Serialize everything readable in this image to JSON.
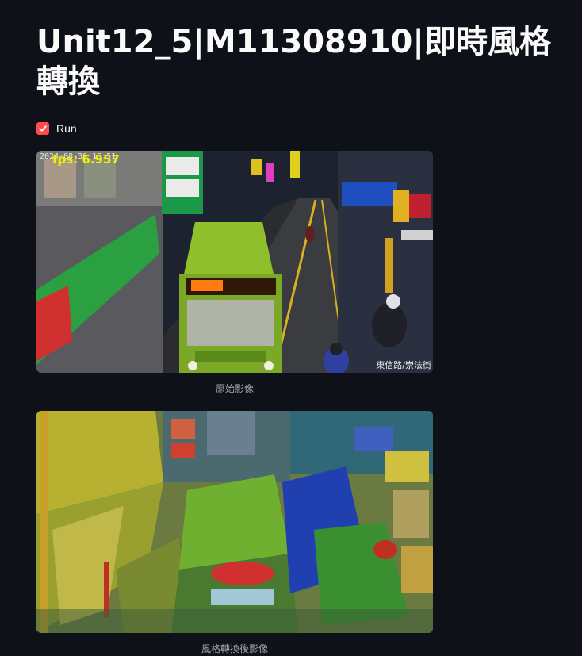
{
  "page": {
    "title": "Unit12_5|M11308910|即時風格轉換"
  },
  "controls": {
    "run_label": "Run",
    "run_checked": true
  },
  "original_image": {
    "timestamp": "2024-08-30 16:51",
    "fps_text": "fps: 6.957",
    "location_text": "東信路/崇法街",
    "caption": "原始影像"
  },
  "styled_image": {
    "caption": "風格轉換後影像"
  },
  "colors": {
    "background": "#0e1117",
    "accent": "#ff4b4b",
    "fps_overlay": "#f2f200",
    "caption": "#a3a8b4"
  },
  "icons": {
    "checkbox": "checkmark-icon"
  }
}
